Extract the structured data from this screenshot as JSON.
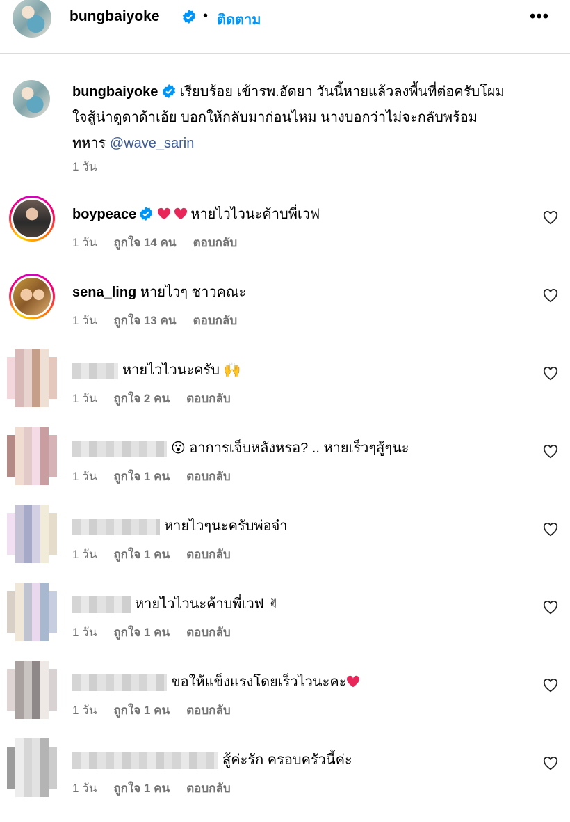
{
  "header": {
    "username": "bungbaiyoke",
    "separator": "•",
    "follow_label": "ติดตาม",
    "more_label": "•••"
  },
  "post": {
    "username": "bungbaiyoke",
    "caption_line1": "เรียบร้อย เข้ารพ.อัดยา วันนี้หายแล้วลงพื้นที่ต่อครับโผม",
    "caption_line2": "ใจสู้น่าดูดาด้าเอ้ย บอกให้กลับมาก่อนไหม นางบอกว่าไม่จะกลับพร้อม",
    "caption_line3_pre": "ทหาร ",
    "mention": "@wave_sarin",
    "time": "1 วัน"
  },
  "comments": [
    {
      "username": "boypeace",
      "text": "หายไวไวนะค้าบพี่เวฟ",
      "time": "1 วัน",
      "likes": "ถูกใจ 14 คน",
      "reply": "ตอบกลับ"
    },
    {
      "username": "sena_ling",
      "text": "หายไวๆ ชาวคณะ",
      "time": "1 วัน",
      "likes": "ถูกใจ 13 คน",
      "reply": "ตอบกลับ"
    },
    {
      "username": "",
      "text": "หายไวไวนะครับ 🙌",
      "time": "1 วัน",
      "likes": "ถูกใจ 2 คน",
      "reply": "ตอบกลับ"
    },
    {
      "username": "",
      "text": "😮 อาการเจ็บหลังหรอ? .. หายเร็วๆสู้ๆนะ",
      "time": "1 วัน",
      "likes": "ถูกใจ 1 คน",
      "reply": "ตอบกลับ"
    },
    {
      "username": "",
      "text": "หายไวๆนะครับพ่อจ๋า",
      "time": "1 วัน",
      "likes": "ถูกใจ 1 คน",
      "reply": "ตอบกลับ"
    },
    {
      "username": "",
      "text": "หายไวไวนะค้าบพี่เวฟ ✌",
      "time": "1 วัน",
      "likes": "ถูกใจ 1 คน",
      "reply": "ตอบกลับ"
    },
    {
      "username": "",
      "text": "ขอให้แข็งแรงโดยเร็วไวนะคะ",
      "time": "1 วัน",
      "likes": "ถูกใจ 1 คน",
      "reply": "ตอบกลับ"
    },
    {
      "username": "",
      "text": "สู้ค่ะรัก ครอบครัวนี้ค่ะ",
      "time": "1 วัน",
      "likes": "ถูกใจ 1 คน",
      "reply": "ตอบกลับ"
    }
  ],
  "colors": {
    "accent": "#0095f6",
    "verified": "#0095f6",
    "heart": "#ed1f4f",
    "muted": "#737373"
  }
}
